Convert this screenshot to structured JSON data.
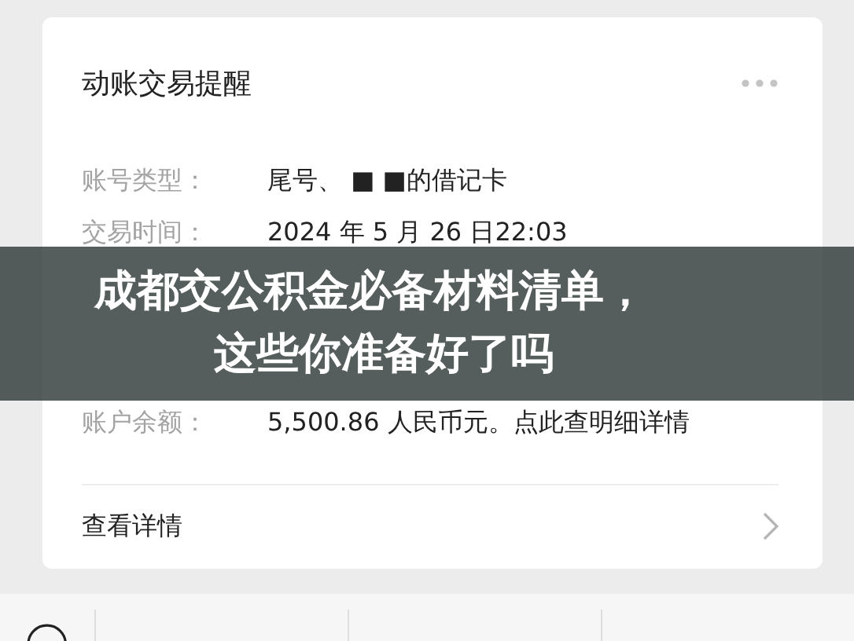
{
  "card": {
    "title": "动账交易提醒",
    "rows": [
      {
        "label": "账号类型：",
        "value": "尾号、 ■ ■的借记卡"
      },
      {
        "label": "交易时间：",
        "value": "2024 年 5 月 26 日22:03"
      },
      {
        "label": "账户余额：",
        "value": "5,500.86 人民币元。点此查明细详情"
      }
    ],
    "footer_link": "查看详情"
  },
  "banner": {
    "lines": [
      "成都交公积金必备材料清单，",
      "这些你准备好了吗"
    ]
  }
}
